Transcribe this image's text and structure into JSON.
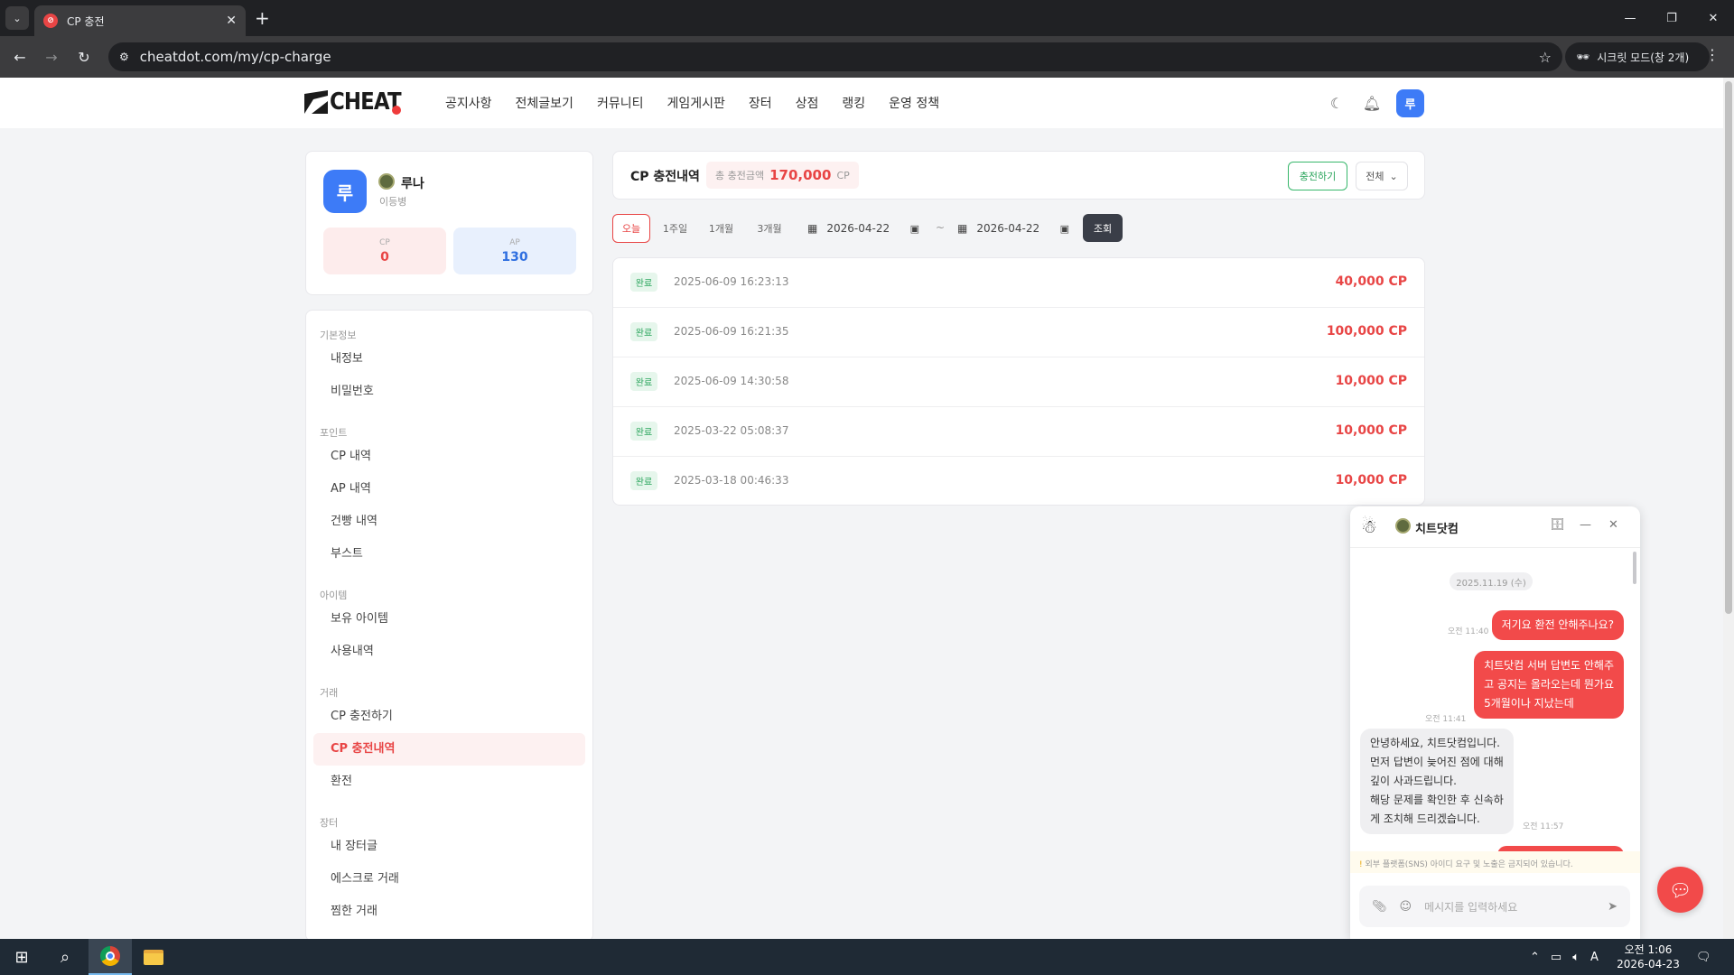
{
  "browser": {
    "tab_title": "CP 충전",
    "url": "cheatdot.com/my/cp-charge",
    "incognito_label": "시크릿 모드(창 2개)"
  },
  "site": {
    "logo_text": "CHEAT",
    "nav": [
      "공지사항",
      "전체글보기",
      "커뮤니티",
      "게임게시판",
      "장터",
      "상점",
      "랭킹",
      "운영 정책"
    ],
    "avatar_initial": "루"
  },
  "profile": {
    "avatar_initial": "루",
    "name": "루나",
    "rank": "이등병",
    "cp_label": "CP",
    "cp_value": "0",
    "ap_label": "AP",
    "ap_value": "130"
  },
  "menu": {
    "sections": [
      {
        "title": "기본정보",
        "items": [
          "내정보",
          "비밀번호"
        ]
      },
      {
        "title": "포인트",
        "items": [
          "CP 내역",
          "AP 내역",
          "건빵 내역",
          "부스트"
        ]
      },
      {
        "title": "아이템",
        "items": [
          "보유 아이템",
          "사용내역"
        ]
      },
      {
        "title": "거래",
        "items": [
          "CP 충전하기",
          "CP 충전내역",
          "환전"
        ]
      },
      {
        "title": "장터",
        "items": [
          "내 장터글",
          "에스크로 거래",
          "찜한 거래"
        ]
      }
    ],
    "active": "CP 충전내역"
  },
  "history": {
    "title": "CP 충전내역",
    "total_label": "총 충전금액",
    "total_value": "170,000",
    "total_unit": "CP",
    "charge_button": "충전하기",
    "filter_value": "전체",
    "periods": [
      "오늘",
      "1주일",
      "1개월",
      "3개월"
    ],
    "active_period": "오늘",
    "date_from": "2026-04-22",
    "date_to": "2026-04-22",
    "date_separator": "~",
    "search_button": "조회",
    "records": [
      {
        "status": "완료",
        "datetime": "2025-06-09 16:23:13",
        "amount": "40,000 CP"
      },
      {
        "status": "완료",
        "datetime": "2025-06-09 16:21:35",
        "amount": "100,000 CP"
      },
      {
        "status": "완료",
        "datetime": "2025-06-09 14:30:58",
        "amount": "10,000 CP"
      },
      {
        "status": "완료",
        "datetime": "2025-03-22 05:08:37",
        "amount": "10,000 CP"
      },
      {
        "status": "완료",
        "datetime": "2025-03-18 00:46:33",
        "amount": "10,000 CP"
      }
    ]
  },
  "chat": {
    "title": "치트닷컴",
    "date": "2025.11.19 (수)",
    "messages": [
      {
        "from": "me",
        "time": "오전 11:40",
        "lines": [
          "저기요 환전 안해주나요?"
        ]
      },
      {
        "from": "me",
        "time": "오전 11:41",
        "lines": [
          "치트닷컴 서버 답변도 안해주",
          "고 공지는 올라오는데 뭔가요",
          "5개월이나 지났는데"
        ]
      },
      {
        "from": "them",
        "time": "오전 11:57",
        "lines": [
          "안녕하세요, 치트닷컴입니다.",
          "먼저 답변이 늦어진 점에 대해",
          "깊이 사과드립니다.",
          "해당 문제를 확인한 후 신속하",
          "게 조치해 드리겠습니다."
        ]
      }
    ],
    "notice": "외부 플랫폼(SNS) 아이디 요구 및 노출은 금지되어 있습니다.",
    "input_placeholder": "메시지를 입력하세요"
  },
  "taskbar": {
    "time": "오전 1:06",
    "date": "2026-04-23",
    "ime": "A"
  },
  "colors": {
    "accent_red": "#e84545",
    "accent_blue": "#3d7bf7",
    "success_green": "#2aa55c",
    "dark_button": "#3a3e48"
  }
}
